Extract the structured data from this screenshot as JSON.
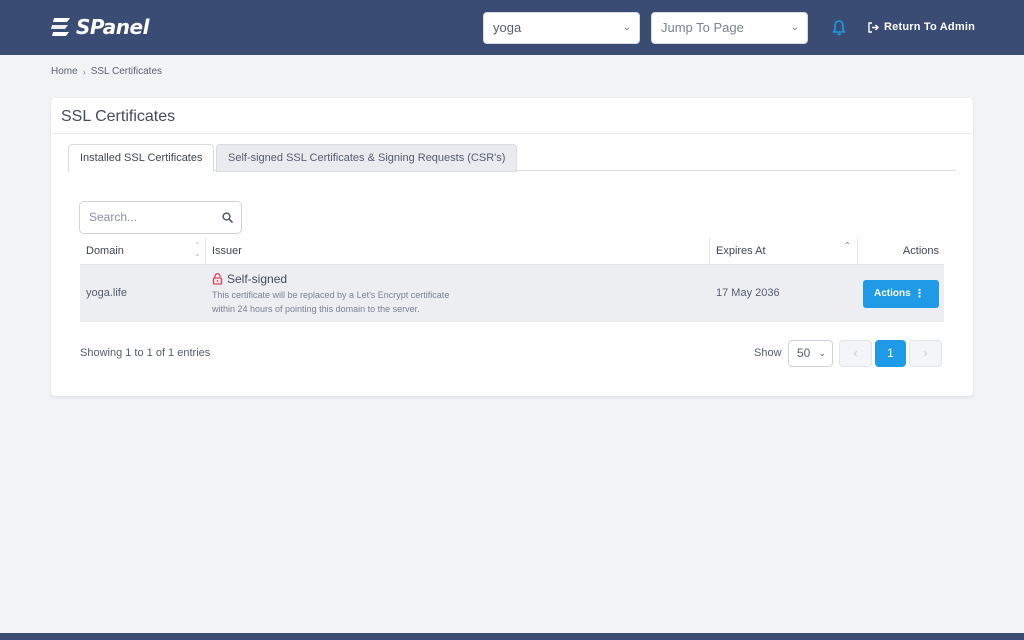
{
  "brand": {
    "logo_text": "SPanel"
  },
  "header": {
    "user_select": {
      "value": "yoga"
    },
    "jump_select": {
      "placeholder": "Jump To Page"
    },
    "return_admin_label": "Return To Admin"
  },
  "breadcrumb": {
    "home": "Home",
    "current": "SSL Certificates"
  },
  "card": {
    "title": "SSL Certificates"
  },
  "tabs": [
    {
      "label": "Installed SSL Certificates",
      "active": true
    },
    {
      "label": "Self-signed SSL Certificates & Signing Requests (CSR's)",
      "active": false
    }
  ],
  "search": {
    "placeholder": "Search..."
  },
  "table": {
    "columns": {
      "domain": "Domain",
      "issuer": "Issuer",
      "expires": "Expires At",
      "actions": "Actions"
    },
    "rows": [
      {
        "domain": "yoga.life",
        "issuer_title": "Self-signed",
        "issuer_desc": "This certificate will be replaced by a Let's Encrypt certificate within 24 hours of pointing this domain to the server.",
        "expires": "17 May 2036",
        "action_label": "Actions"
      }
    ]
  },
  "pagination": {
    "info": "Showing 1 to 1 of 1 entries",
    "show_label": "Show",
    "page_size": "50",
    "prev": "‹",
    "current": "1",
    "next": "›"
  },
  "colors": {
    "header_bg": "#3a4c74",
    "accent": "#1e9ae6",
    "warning_icon": "#e0424f"
  }
}
